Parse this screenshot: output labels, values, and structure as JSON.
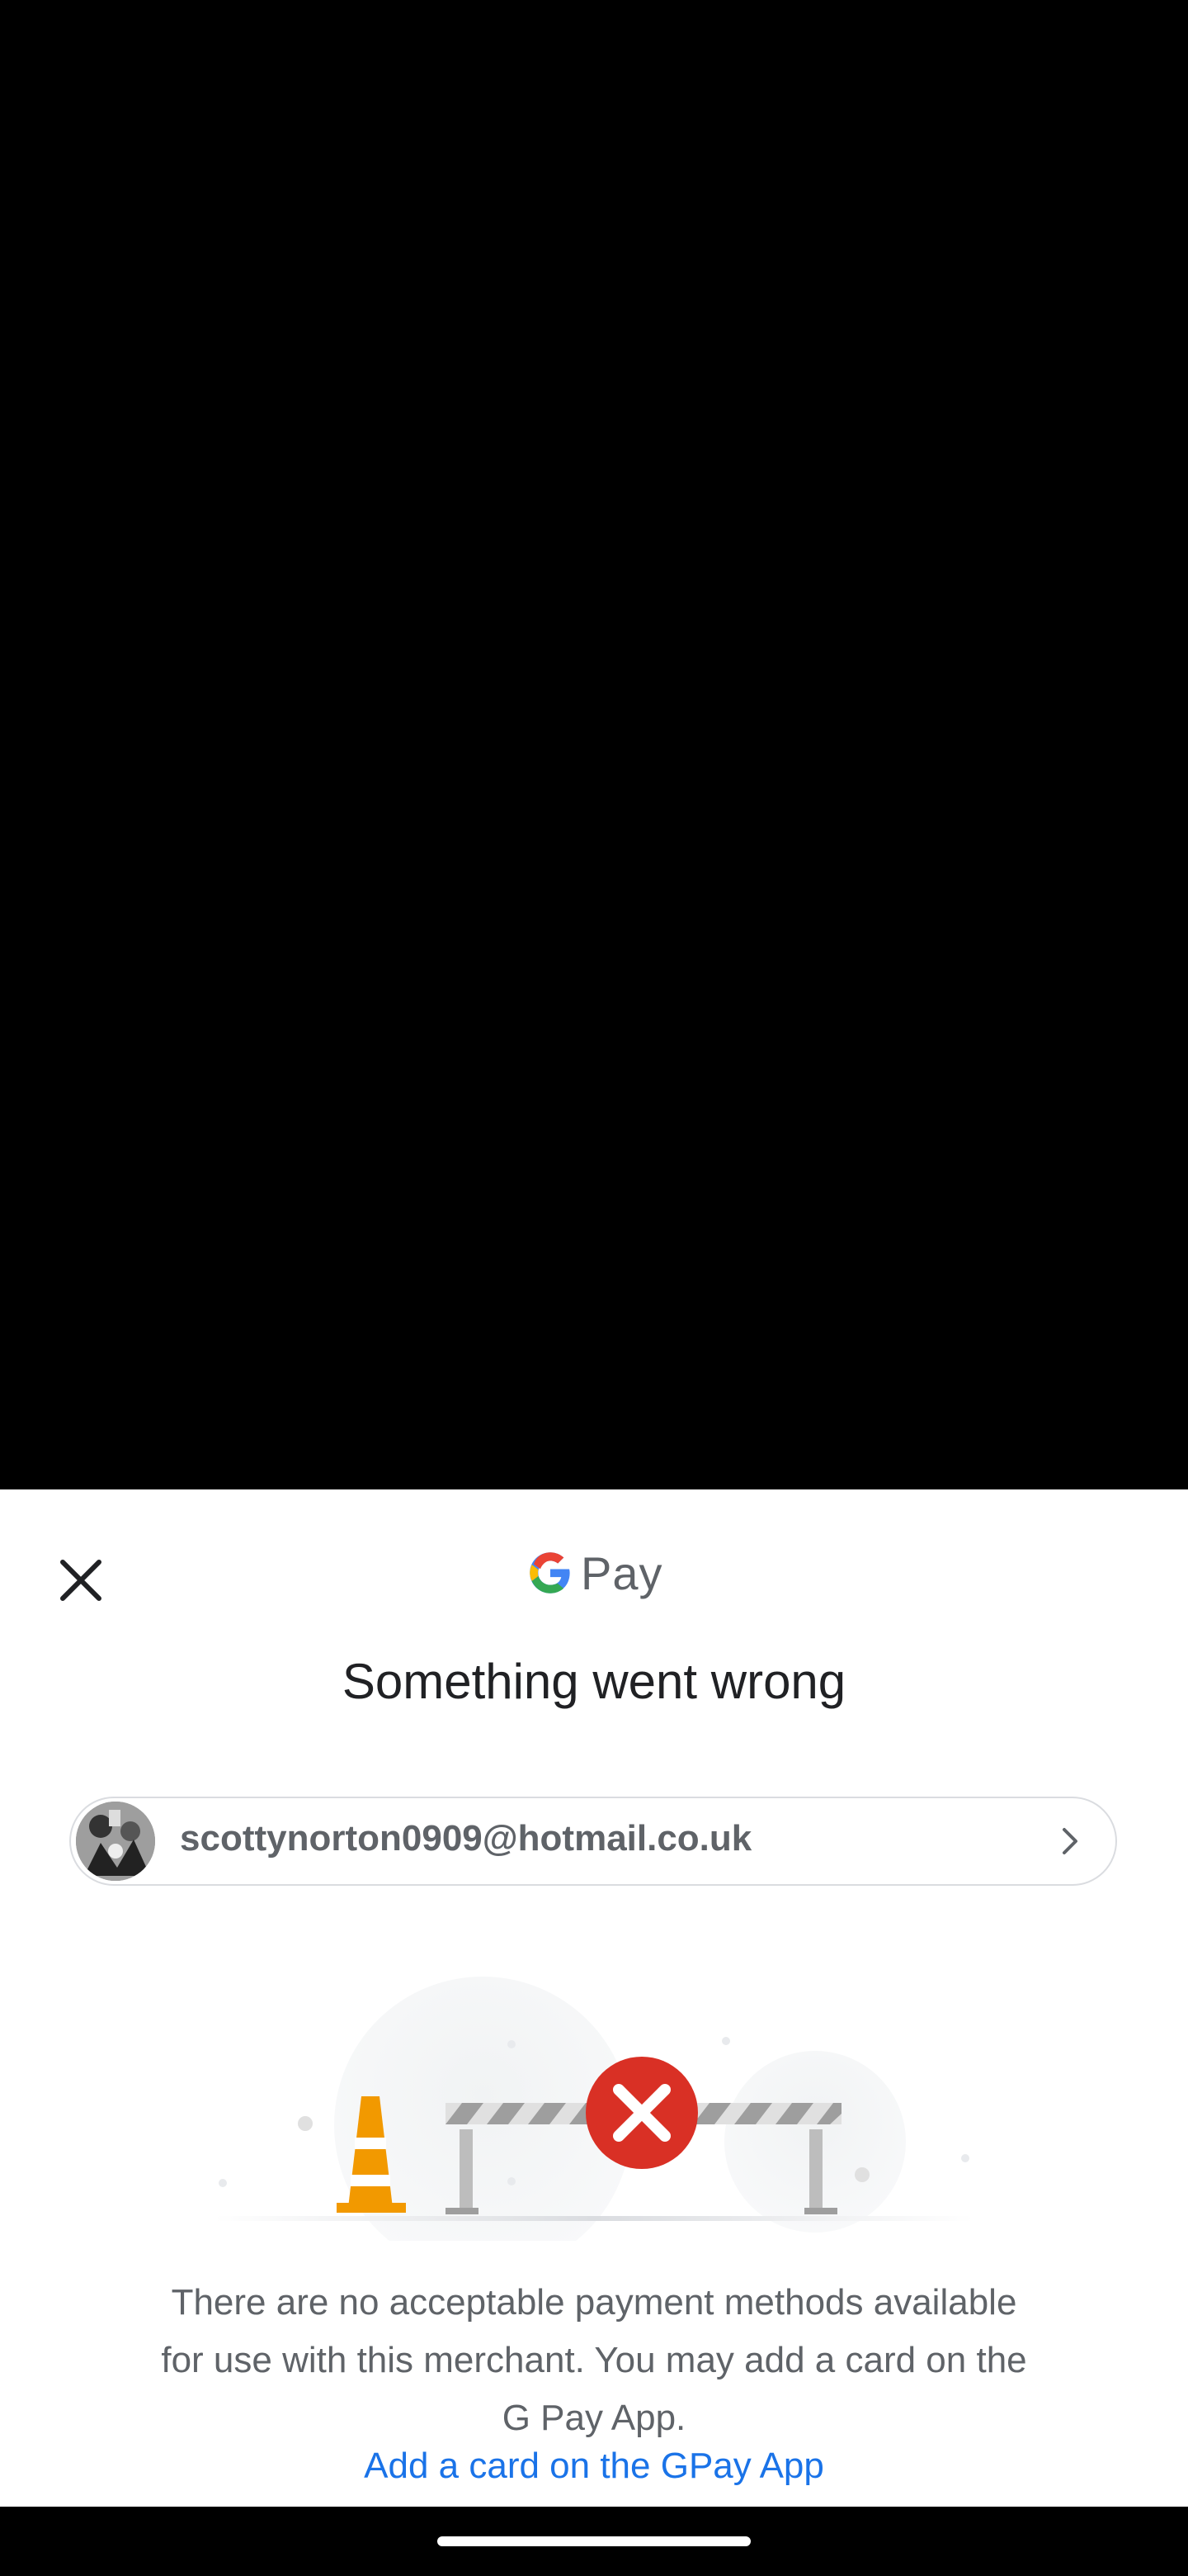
{
  "sheet": {
    "brand": {
      "g_letter": "G",
      "pay": "Pay"
    },
    "title": "Something went wrong",
    "account": {
      "email": "scottynorton0909@hotmail.co.uk"
    },
    "message": "There are no acceptable payment methods available for use with this merchant. You may add a card on the G Pay App.",
    "link": "Add a card on the GPay App"
  },
  "colors": {
    "link": "#1a73e8",
    "error_badge": "#d93025",
    "cone": "#f29900",
    "text_primary": "#202124",
    "text_secondary": "#5f6368"
  },
  "icons": {
    "close": "close-icon",
    "chevron": "chevron-right-icon",
    "error": "error-x-icon"
  }
}
